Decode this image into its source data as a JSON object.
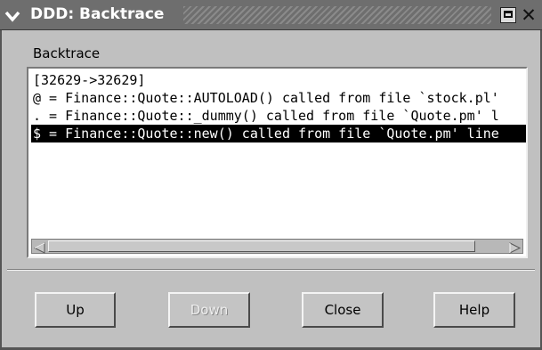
{
  "window": {
    "title": "DDD: Backtrace"
  },
  "panel": {
    "label": "Backtrace"
  },
  "list": {
    "items": [
      {
        "text": "[32629->32629]",
        "selected": false
      },
      {
        "text": "@ = Finance::Quote::AUTOLOAD() called from file `stock.pl'",
        "selected": false
      },
      {
        "text": ". = Finance::Quote::_dummy() called from file `Quote.pm' l",
        "selected": false
      },
      {
        "text": "$ = Finance::Quote::new() called from file `Quote.pm' line",
        "selected": true
      }
    ]
  },
  "buttons": {
    "up": "Up",
    "down": "Down",
    "close": "Close",
    "help": "Help"
  },
  "icons": {
    "window_menu": "chevron-down-icon",
    "maximize": "maximize-icon",
    "close": "close-icon",
    "scroll_left": "arrow-left-icon",
    "scroll_right": "arrow-right-icon"
  },
  "colors": {
    "titlebar": "#6e6e6e",
    "selection_bg": "#000000",
    "selection_fg": "#ffffff",
    "panel_bg": "#c0c0c0"
  }
}
